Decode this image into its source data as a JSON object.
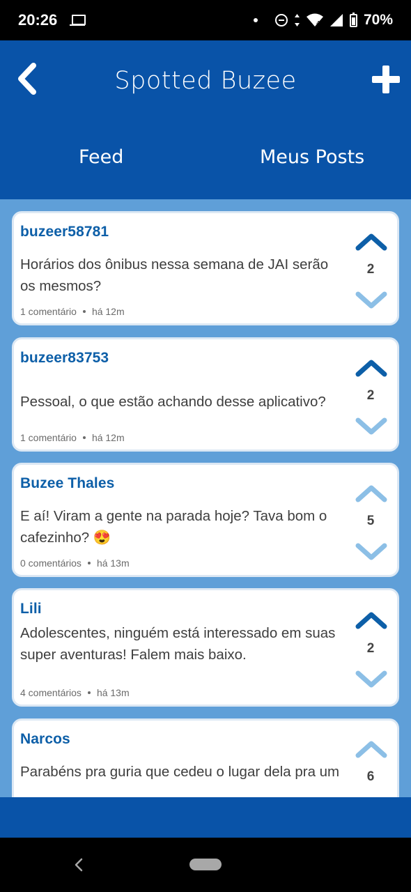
{
  "status_bar": {
    "time": "20:26",
    "battery": "70%"
  },
  "header": {
    "title": "Spotted Buzee",
    "tabs": [
      {
        "label": "Feed"
      },
      {
        "label": "Meus Posts"
      }
    ]
  },
  "posts": [
    {
      "author": "buzeer58781",
      "text": "Horários dos ônibus nessa semana de JAI serão os mesmos?",
      "comments": "1 comentário",
      "time": "há 12m",
      "votes": "2",
      "upvoted": true
    },
    {
      "author": "buzeer83753",
      "text": "Pessoal, o que estão achando desse aplicativo?",
      "comments": "1 comentário",
      "time": "há 12m",
      "votes": "2",
      "upvoted": true
    },
    {
      "author": "Buzee Thales",
      "text": "E aí! Viram a gente na parada hoje? Tava bom o cafezinho? 😍",
      "comments": "0 comentários",
      "time": "há 13m",
      "votes": "5",
      "upvoted": false
    },
    {
      "author": "Lili",
      "text": "Adolescentes, ninguém está interessado em suas super aventuras! Falem mais baixo.",
      "comments": "4 comentários",
      "time": "há 13m",
      "votes": "2",
      "upvoted": true
    },
    {
      "author": "Narcos",
      "text": "Parabéns pra guria que cedeu o lugar dela pra um",
      "votes": "6",
      "upvoted": false
    }
  ],
  "colors": {
    "primary": "#0953A8",
    "feed_background": "#5F9FD8",
    "author": "#0D5FA8",
    "vote_active": "#0D5FA8",
    "vote_inactive": "#8CBFE6"
  },
  "icons": {
    "back": "chevron-left-icon",
    "add": "plus-icon",
    "upvote": "chevron-up-icon",
    "downvote": "chevron-down-icon"
  }
}
